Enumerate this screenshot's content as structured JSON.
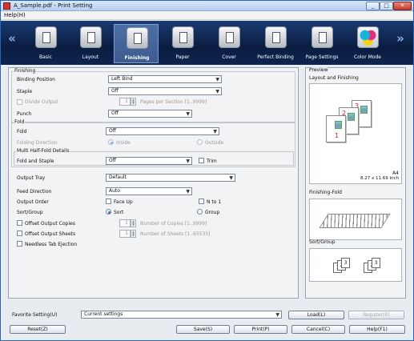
{
  "window": {
    "title": "A_Sample.pdf - Print Setting",
    "minimize": "_",
    "maximize": "□",
    "close": "✕"
  },
  "menubar": {
    "help": "Help(H)"
  },
  "toolbar": {
    "items": [
      {
        "label": "Basic",
        "icon": "basic-icon"
      },
      {
        "label": "Layout",
        "icon": "layout-icon"
      },
      {
        "label": "Finishing",
        "icon": "finishing-icon",
        "active": true
      },
      {
        "label": "Paper",
        "icon": "paper-icon"
      },
      {
        "label": "Cover",
        "icon": "cover-icon"
      },
      {
        "label": "Perfect Binding",
        "icon": "perfect-binding-icon"
      },
      {
        "label": "Page Settings",
        "icon": "page-settings-icon"
      },
      {
        "label": "Color Mode",
        "icon": "color-mode-icon"
      }
    ],
    "prev": "«",
    "next": "»"
  },
  "finishing": {
    "legend": "Finishing",
    "binding_position_label": "Binding Position",
    "binding_position_value": "Left Bind",
    "staple_label": "Staple",
    "staple_value": "Off",
    "divide_output_label": "Divide Output",
    "pages_per_section_value": "1",
    "pages_per_section_label": "Pages per Section [1..9999]",
    "punch_label": "Punch",
    "punch_value": "Off"
  },
  "fold": {
    "legend": "Fold",
    "fold_label": "Fold",
    "fold_value": "Off",
    "folding_direction_label": "Folding Direction",
    "inside_label": "Inside",
    "outside_label": "Outside",
    "multi_half_fold_legend": "Multi Half-Fold Details",
    "fold_and_staple_label": "Fold and Staple",
    "fold_and_staple_value": "Off",
    "trim_label": "Trim"
  },
  "output": {
    "output_tray_label": "Output Tray",
    "output_tray_value": "Default",
    "feed_direction_label": "Feed Direction",
    "feed_direction_value": "Auto",
    "output_order_label": "Output Order",
    "face_up_label": "Face Up",
    "n_to_1_label": "N to 1",
    "sort_group_label": "Sort/Group",
    "sort_label": "Sort",
    "group_label": "Group",
    "offset_copies_label": "Offset Output Copies",
    "number_of_copies_value": "1",
    "number_of_copies_label": "Number of Copies [1..9999]",
    "offset_sheets_label": "Offset Output Sheets",
    "number_of_sheets_value": "1",
    "number_of_sheets_label": "Number of Sheets [1..65535]",
    "needless_tab_label": "Needless Tab Ejection"
  },
  "preview": {
    "legend": "Preview",
    "layout_and_finishing_label": "Layout and Finishing",
    "page_numbers": [
      "3",
      "2",
      "1"
    ],
    "paper_size": "A4",
    "paper_dimensions": "8.27 x 11.69 inch",
    "finishing_fold_label": "Finishing-Fold",
    "sort_group_label": "Sort/Group",
    "sort_pages": [
      "1",
      "2",
      "3"
    ]
  },
  "footer": {
    "favorite_setting_label": "Favorite Setting(U)",
    "favorite_setting_value": "Current settings",
    "load_button": "Load(L)",
    "register_button": "Register(R)",
    "reset_button": "Reset(Z)",
    "save_button": "Save(S)",
    "print_button": "Print(P)",
    "cancel_button": "Cancel(C)",
    "help_button": "Help(F1)"
  }
}
